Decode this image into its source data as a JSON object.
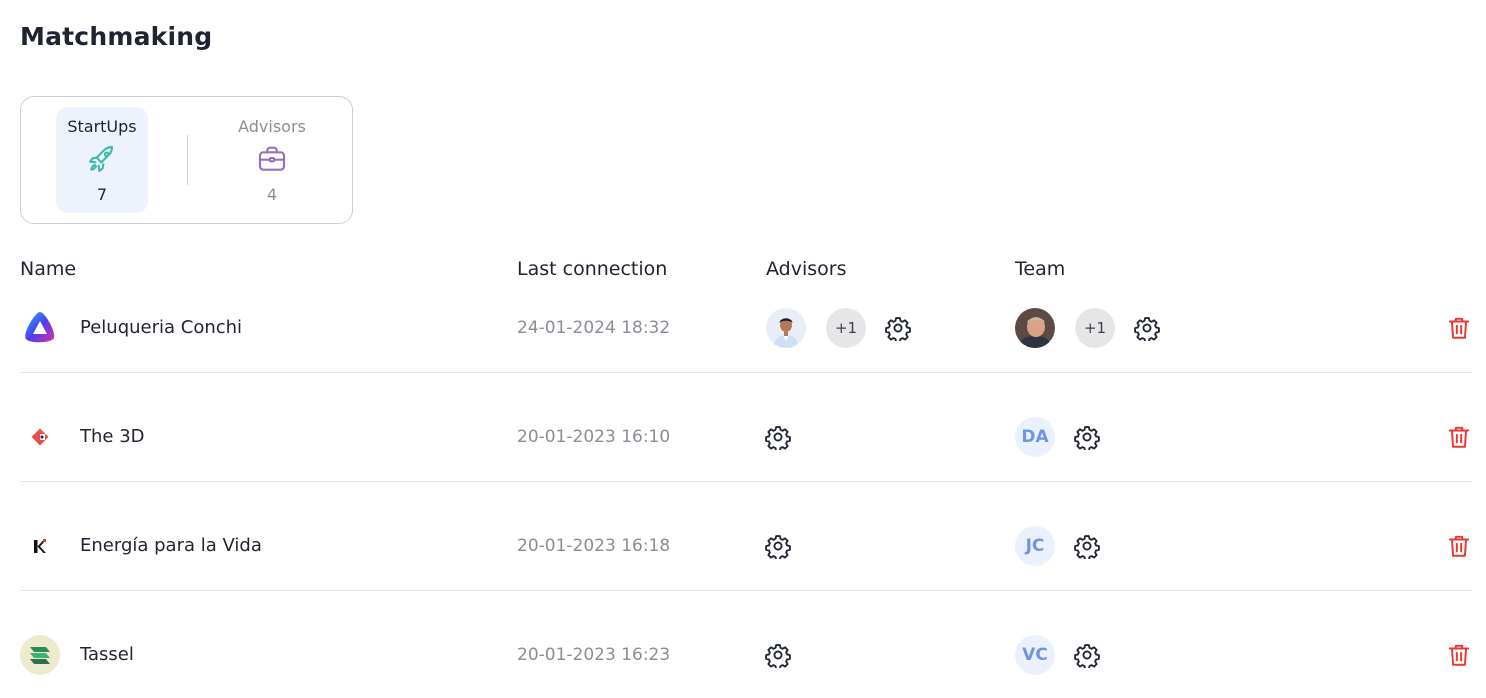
{
  "page": {
    "title": "Matchmaking"
  },
  "tabs": [
    {
      "label": "StartUps",
      "count": "7",
      "icon": "rocket-icon",
      "active": true,
      "color": "#3fb9a9"
    },
    {
      "label": "Advisors",
      "count": "4",
      "icon": "briefcase-icon",
      "active": false,
      "color": "#9a6cc0"
    }
  ],
  "table": {
    "headers": {
      "name": "Name",
      "last_connection": "Last connection",
      "advisors": "Advisors",
      "team": "Team"
    },
    "rows": [
      {
        "name": "Peluqueria Conchi",
        "last_connection": "24-01-2024 18:32",
        "advisors_more": "+1",
        "team_more": "+1"
      },
      {
        "name": "The 3D",
        "last_connection": "20-01-2023 16:10",
        "team_initials": "DA"
      },
      {
        "name": "Energía para la Vida",
        "last_connection": "20-01-2023 16:18",
        "team_initials": "JC"
      },
      {
        "name": "Tassel",
        "last_connection": "20-01-2023 16:23",
        "team_initials": "VC"
      }
    ]
  },
  "colors": {
    "delete": "#e53935",
    "initials_text": "#6e96e0",
    "active_tab_bg": "#eef2fd"
  }
}
